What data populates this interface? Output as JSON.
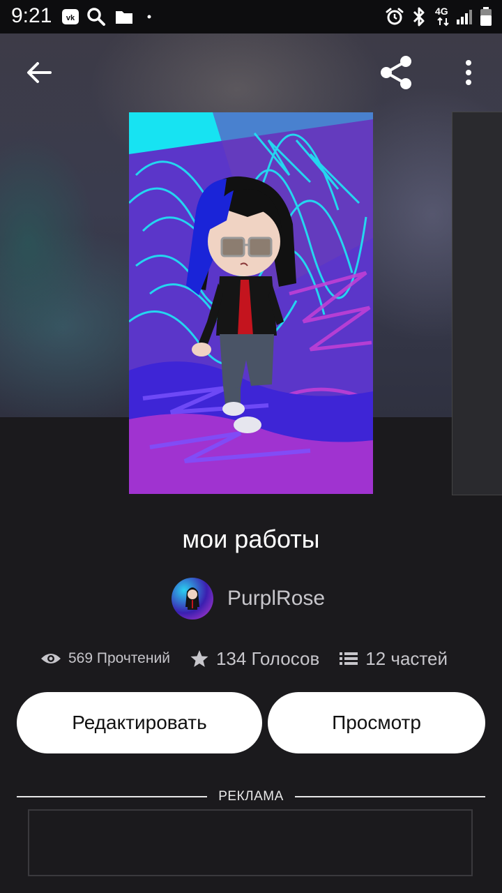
{
  "status_bar": {
    "time": "9:21",
    "icons": [
      "vk-icon",
      "search-icon",
      "folder-icon",
      "dot-icon",
      "alarm-icon",
      "bluetooth-icon",
      "4g-icon",
      "signal-icon",
      "battery-icon"
    ],
    "network_label": "4G"
  },
  "toolbar": {
    "back_icon": "arrow-left-icon",
    "share_icon": "share-icon",
    "menu_icon": "more-vertical-icon"
  },
  "story": {
    "title": "мои работы",
    "author": "PurplRose",
    "stats": {
      "reads": "569 Прочтений",
      "votes": "134 Голосов",
      "parts": "12 частей"
    }
  },
  "actions": {
    "edit_label": "Редактировать",
    "view_label": "Просмотр"
  },
  "ad": {
    "label": "РЕКЛАМА"
  },
  "colors": {
    "background": "#1b1a1d",
    "button_bg": "#ffffff",
    "secondary_text": "#c7c6cb"
  }
}
